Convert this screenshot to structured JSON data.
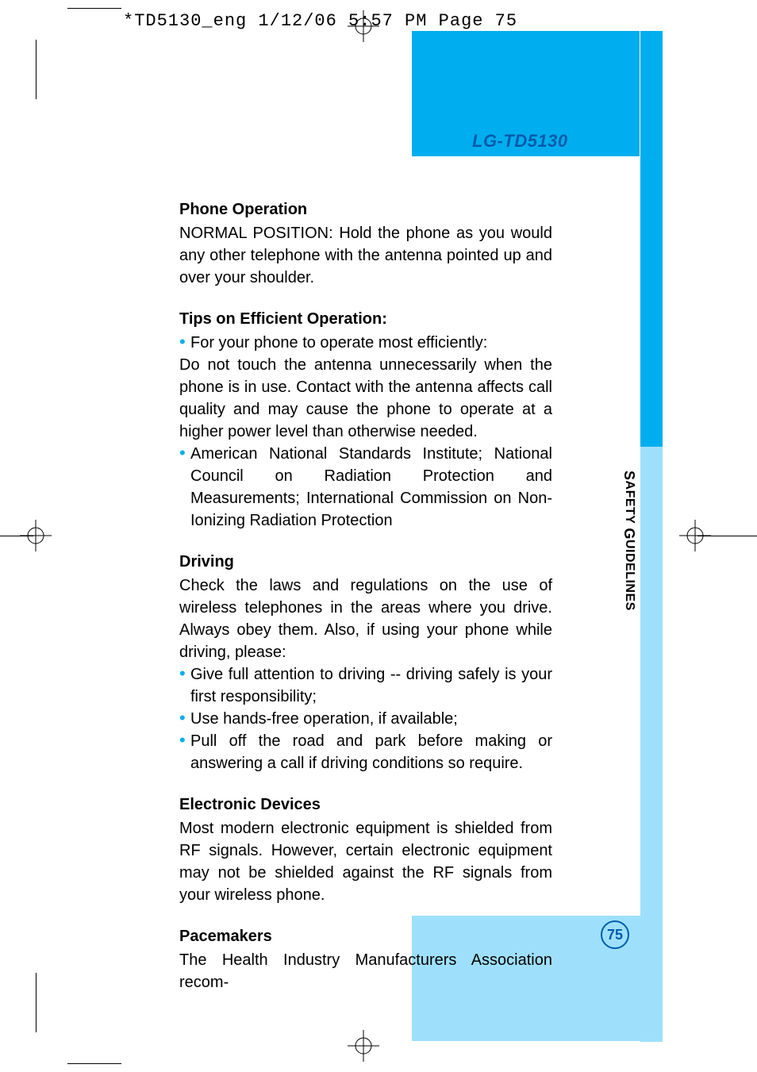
{
  "slug": "*TD5130_eng  1/12/06  5:57 PM  Page 75",
  "model": "LG-TD5130",
  "sideLabel": {
    "s": "S",
    "afety": "AFETY",
    "sp": " ",
    "g": "G",
    "uidelines": "UIDELINES"
  },
  "pageNum": "75",
  "sections": {
    "phoneOp": {
      "h": "Phone Operation",
      "p": "NORMAL POSITION: Hold the phone as you would any other telephone with the antenna pointed up and over your shoulder."
    },
    "tips": {
      "h": "Tips on Efficient Operation:",
      "b1": "For your phone to operate most efficiently:",
      "p": "Do not touch the antenna unnecessarily when the phone is in use. Contact with the antenna affects call quality and may cause the phone to operate at a higher power level than otherwise needed.",
      "b2": "American National Standards Institute; National Council on Radiation Protection and Measurements; International Commission on Non-Ionizing Radiation Protection"
    },
    "driving": {
      "h": "Driving",
      "p": "Check the laws and regulations on the use of wireless telephones in the areas where you drive. Always obey them. Also, if using your phone while driving, please:",
      "b1": "Give full attention to driving -- driving safely is your first responsibility;",
      "b2": "Use hands-free operation, if available;",
      "b3": "Pull off the road and park before making or answering a call if driving conditions so require."
    },
    "elec": {
      "h": "Electronic Devices",
      "p": "Most modern electronic equipment is shielded from RF signals. However, certain electronic equipment may not be shielded against the RF signals from your wireless phone."
    },
    "pace": {
      "h": "Pacemakers",
      "p": "The Health Industry Manufacturers Association recom-"
    }
  }
}
